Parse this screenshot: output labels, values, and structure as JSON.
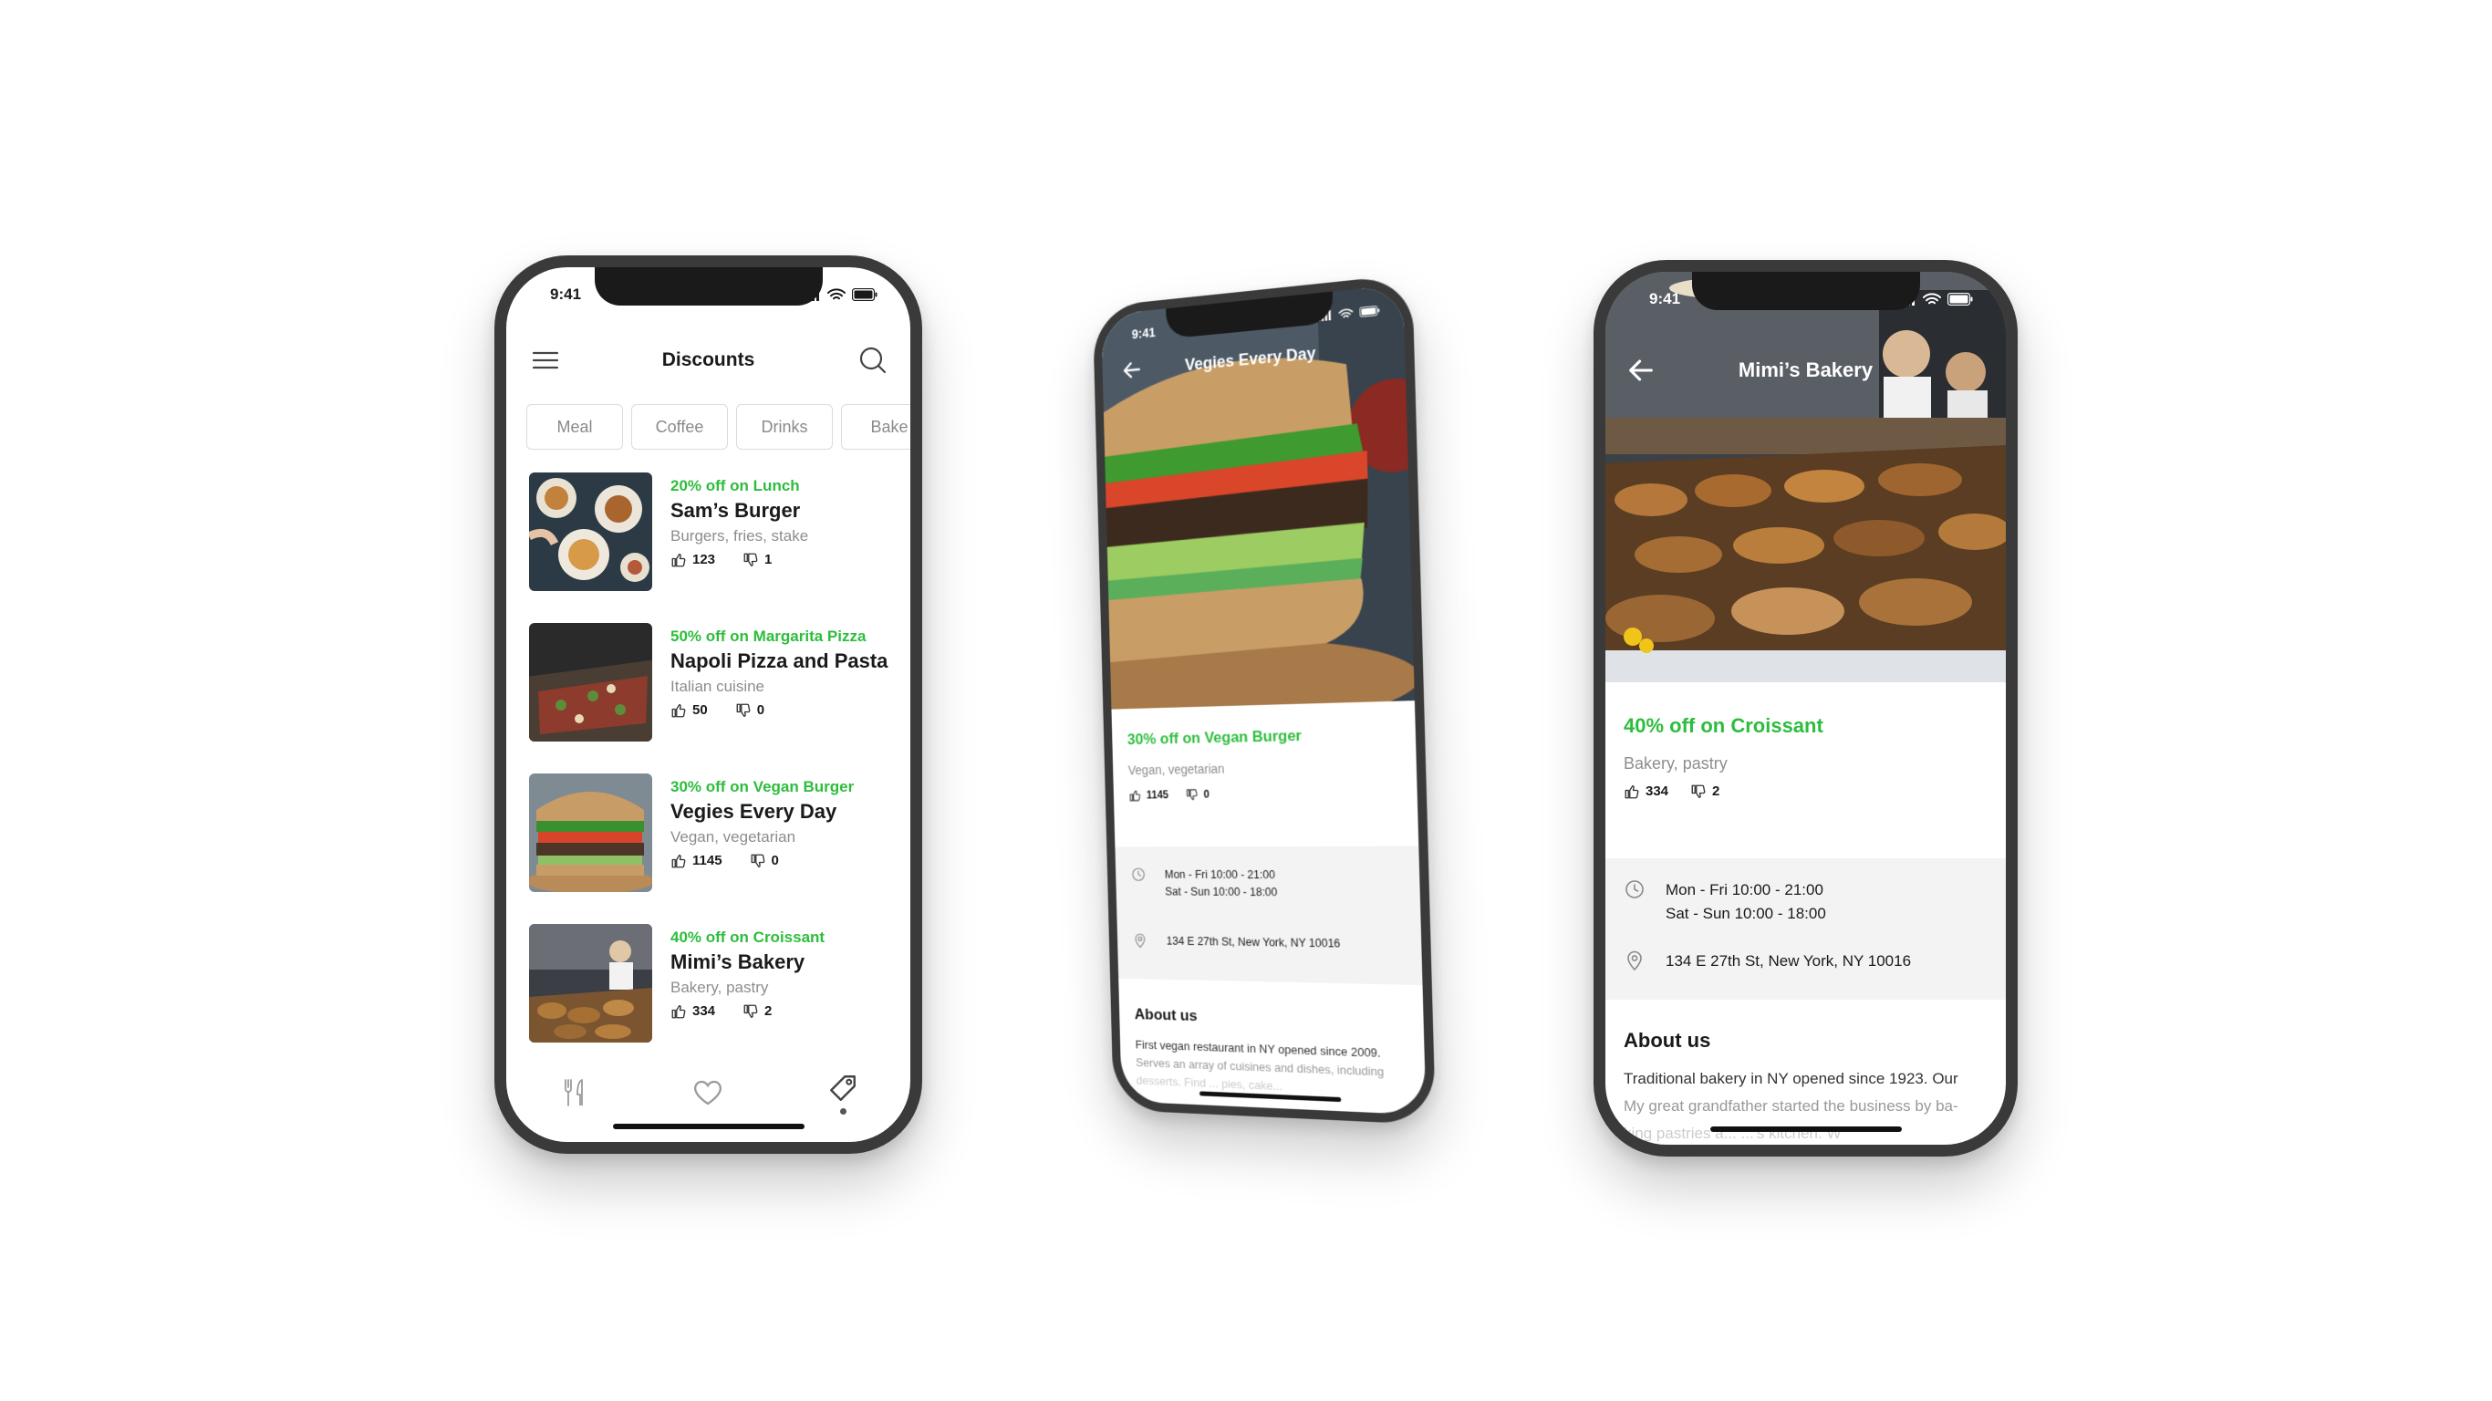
{
  "status_time": "9:41",
  "colors": {
    "accent_green": "#2dbd3c",
    "muted_gray": "#8d8d8d",
    "info_bg": "#f3f3f3"
  },
  "list_screen": {
    "title": "Discounts",
    "menu_icon": "hamburger-menu-icon",
    "search_icon": "search-icon",
    "categories": [
      "Meal",
      "Coffee",
      "Drinks",
      "Bake"
    ],
    "items": [
      {
        "offer": "20% off on Lunch",
        "name": "Sam’s Burger",
        "tags": "Burgers, fries, stake",
        "likes": "123",
        "dislikes": "1"
      },
      {
        "offer": "50% off on Margarita Pizza",
        "name": "Napoli Pizza and Pasta",
        "tags": "Italian cuisine",
        "likes": "50",
        "dislikes": "0"
      },
      {
        "offer": "30% off on Vegan Burger",
        "name": "Vegies Every Day",
        "tags": "Vegan, vegetarian",
        "likes": "1145",
        "dislikes": "0"
      },
      {
        "offer": "40% off on Croissant",
        "name": "Mimi’s Bakery",
        "tags": "Bakery, pastry",
        "likes": "334",
        "dislikes": "2"
      }
    ],
    "tabs": [
      {
        "icon": "fork-knife-icon"
      },
      {
        "icon": "heart-icon"
      },
      {
        "icon": "tag-icon",
        "active": true
      }
    ]
  },
  "vegan_screen": {
    "title": "Vegies Every Day",
    "offer": "30% off on Vegan Burger",
    "tags": "Vegan, vegetarian",
    "likes": "1145",
    "dislikes": "0",
    "hours_1": "Mon - Fri 10:00 - 21:00",
    "hours_2": "Sat - Sun 10:00 - 18:00",
    "address": "134 E 27th St, New York, NY 10016",
    "about_title": "About us",
    "about_line_1": "First vegan restaurant in NY opened since 2009.",
    "about_line_2": "Serves an array of cuisines and dishes, including",
    "about_line_3": "desserts. Find ... pies, cake..."
  },
  "bakery_screen": {
    "title": "Mimi’s Bakery",
    "offer": "40% off on Croissant",
    "tags": "Bakery, pastry",
    "likes": "334",
    "dislikes": "2",
    "hours_1": "Mon - Fri 10:00 - 21:00",
    "hours_2": "Sat - Sun 10:00 - 18:00",
    "address": "134 E 27th St, New York, NY 10016",
    "about_title": "About us",
    "about_line_1": "Traditional bakery in NY opened since 1923. Our",
    "about_line_2": "My great grandfather started the business by ba-",
    "about_line_3": "king pastries a...                    ...'s kitchen. W"
  }
}
